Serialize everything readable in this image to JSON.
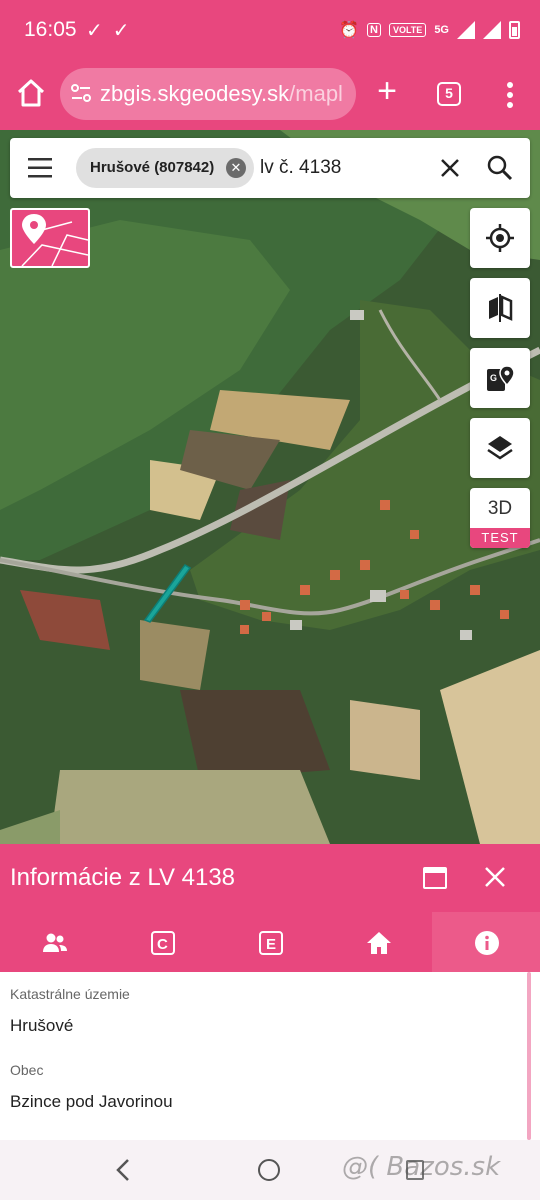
{
  "status_bar": {
    "time": "16:05",
    "left_icons": [
      "check-icon",
      "check-icon"
    ],
    "right_icons": [
      "alarm-icon",
      "nfc-icon",
      "volte-icon",
      "signal-5g-icon",
      "signal-icon",
      "battery-icon"
    ],
    "volte": "VOLTE",
    "network": "5G"
  },
  "browser": {
    "url_host": "zbgis.skgeodesy.sk",
    "url_path": "/mapl",
    "tab_count": "5"
  },
  "search": {
    "chip_label": "Hrušové (807842)",
    "query": "lv č. 4138"
  },
  "map_controls": {
    "btn_3d_label": "3D",
    "btn_3d_badge": "TEST"
  },
  "panel": {
    "title": "Informácie z LV 4138",
    "tabs": [
      {
        "icon": "people-icon"
      },
      {
        "icon": "c-letter-icon"
      },
      {
        "icon": "e-letter-icon"
      },
      {
        "icon": "house-icon"
      },
      {
        "icon": "info-icon",
        "active": true
      }
    ],
    "fields": [
      {
        "label": "Katastrálne územie",
        "value": "Hrušové"
      },
      {
        "label": "Obec",
        "value": "Bzince pod Javorinou"
      }
    ]
  },
  "watermark": "@( Bazos.sk",
  "colors": {
    "accent": "#e8477e",
    "parcel": "#1aa59a"
  }
}
